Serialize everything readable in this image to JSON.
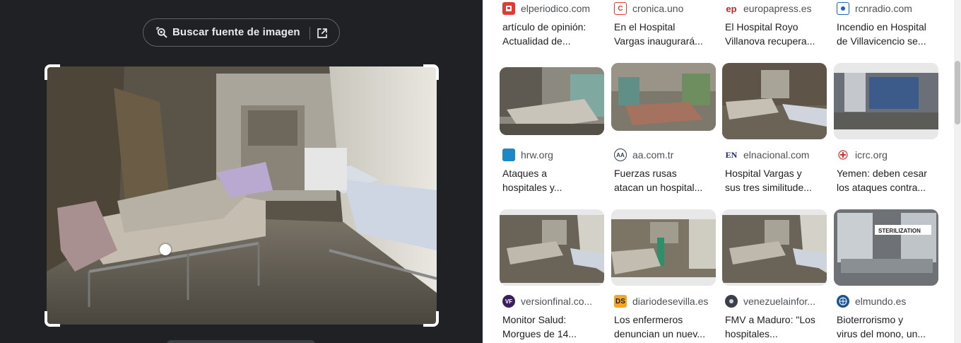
{
  "search_source": {
    "label": "Buscar fuente de imagen"
  },
  "colors": {
    "left_bg": "#202124",
    "accent_text": "#e8eaed",
    "source_text": "#4d5156",
    "title_text": "#202124"
  },
  "results": [
    {
      "source": "elperiodico.com",
      "favicon": "elperiodico-favicon",
      "title_line1": "artículo de opinión:",
      "title_line2": "Actualidad de..."
    },
    {
      "source": "cronica.uno",
      "favicon": "cronica-favicon",
      "title_line1": "En el Hospital",
      "title_line2": "Vargas inaugurará..."
    },
    {
      "source": "europapress.es",
      "favicon": "europapress-favicon",
      "title_line1": "El Hospital Royo",
      "title_line2": "Villanova recupera..."
    },
    {
      "source": "rcnradio.com",
      "favicon": "rcnradio-favicon",
      "title_line1": "Incendio en Hospital",
      "title_line2": "de Villavicencio se..."
    },
    {
      "source": "hrw.org",
      "favicon": "hrw-favicon",
      "title_line1": "Ataques a",
      "title_line2": "hospitales y..."
    },
    {
      "source": "aa.com.tr",
      "favicon": "aa-favicon",
      "title_line1": "Fuerzas rusas",
      "title_line2": "atacan un hospital..."
    },
    {
      "source": "elnacional.com",
      "favicon": "elnacional-favicon",
      "title_line1": "Hospital Vargas y",
      "title_line2": "sus tres similitude..."
    },
    {
      "source": "icrc.org",
      "favicon": "icrc-favicon",
      "title_line1": "Yemen: deben cesar",
      "title_line2": "los ataques contra..."
    },
    {
      "source": "versionfinal.co...",
      "favicon": "versionfinal-favicon",
      "title_line1": "Monitor Salud:",
      "title_line2": "Morgues de 14..."
    },
    {
      "source": "diariodesevilla.es",
      "favicon": "diariodesevilla-favicon",
      "title_line1": "Los enfermeros",
      "title_line2": "denuncian un nuev..."
    },
    {
      "source": "venezuelainfor...",
      "favicon": "venezuelainfo-favicon",
      "title_line1": "FMV a Maduro: \"Los",
      "title_line2": "hospitales..."
    },
    {
      "source": "elmundo.es",
      "favicon": "elmundo-favicon",
      "title_line1": "Bioterrorismo y",
      "title_line2": "virus del mono, un..."
    }
  ],
  "thumb_labels": {
    "sterilization": "STERILIZATION"
  },
  "favicon_text": {
    "ep": "ep",
    "en": "EN",
    "vf": "VF",
    "ds": "DS",
    "aa": "AA"
  }
}
